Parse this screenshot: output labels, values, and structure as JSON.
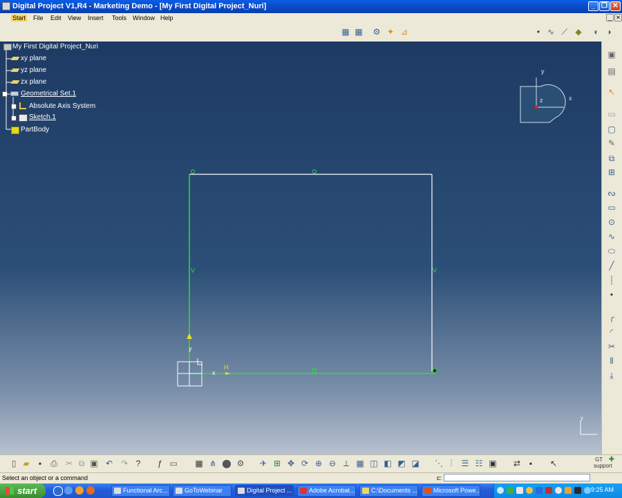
{
  "window": {
    "title": "Digital Project V1,R4  - Marketing Demo - [My First Digital Project_Nuri]"
  },
  "menu": {
    "items": [
      "Start",
      "File",
      "Edit",
      "View",
      "Insert",
      "Tools",
      "Window",
      "Help"
    ]
  },
  "tree": {
    "root": "My First Digital Project_Nuri",
    "items": [
      {
        "label": "xy plane"
      },
      {
        "label": "yz plane"
      },
      {
        "label": "zx plane"
      },
      {
        "label": "Geometrical Set.1"
      },
      {
        "label": "Absolute Axis System"
      },
      {
        "label": "Sketch.1"
      },
      {
        "label": "PartBody"
      }
    ]
  },
  "compass": {
    "y": "y",
    "z": "z",
    "x": "x"
  },
  "sketch": {
    "axis_y": "y",
    "axis_x": "x",
    "constraint_h": "H",
    "constraint_v": "V",
    "corner_y": "y"
  },
  "status": {
    "message": "Select an object or a command",
    "cmd_label": "c:",
    "cmd_value": ""
  },
  "support": {
    "line1": "GT",
    "line2": "support"
  },
  "taskbar": {
    "start": "start",
    "tasks": [
      {
        "label": "Functional Arc..."
      },
      {
        "label": "GoToWebinar"
      },
      {
        "label": "Digital Project ..."
      },
      {
        "label": "Adobe Acrobat..."
      },
      {
        "label": "C:\\Documents ..."
      },
      {
        "label": "Microsoft Powe..."
      }
    ],
    "clock": "9:25 AM"
  },
  "colors": {
    "viewport_top": "#1d3a63",
    "sketch_white": "#ffffff",
    "sketch_green": "#2de02d"
  }
}
